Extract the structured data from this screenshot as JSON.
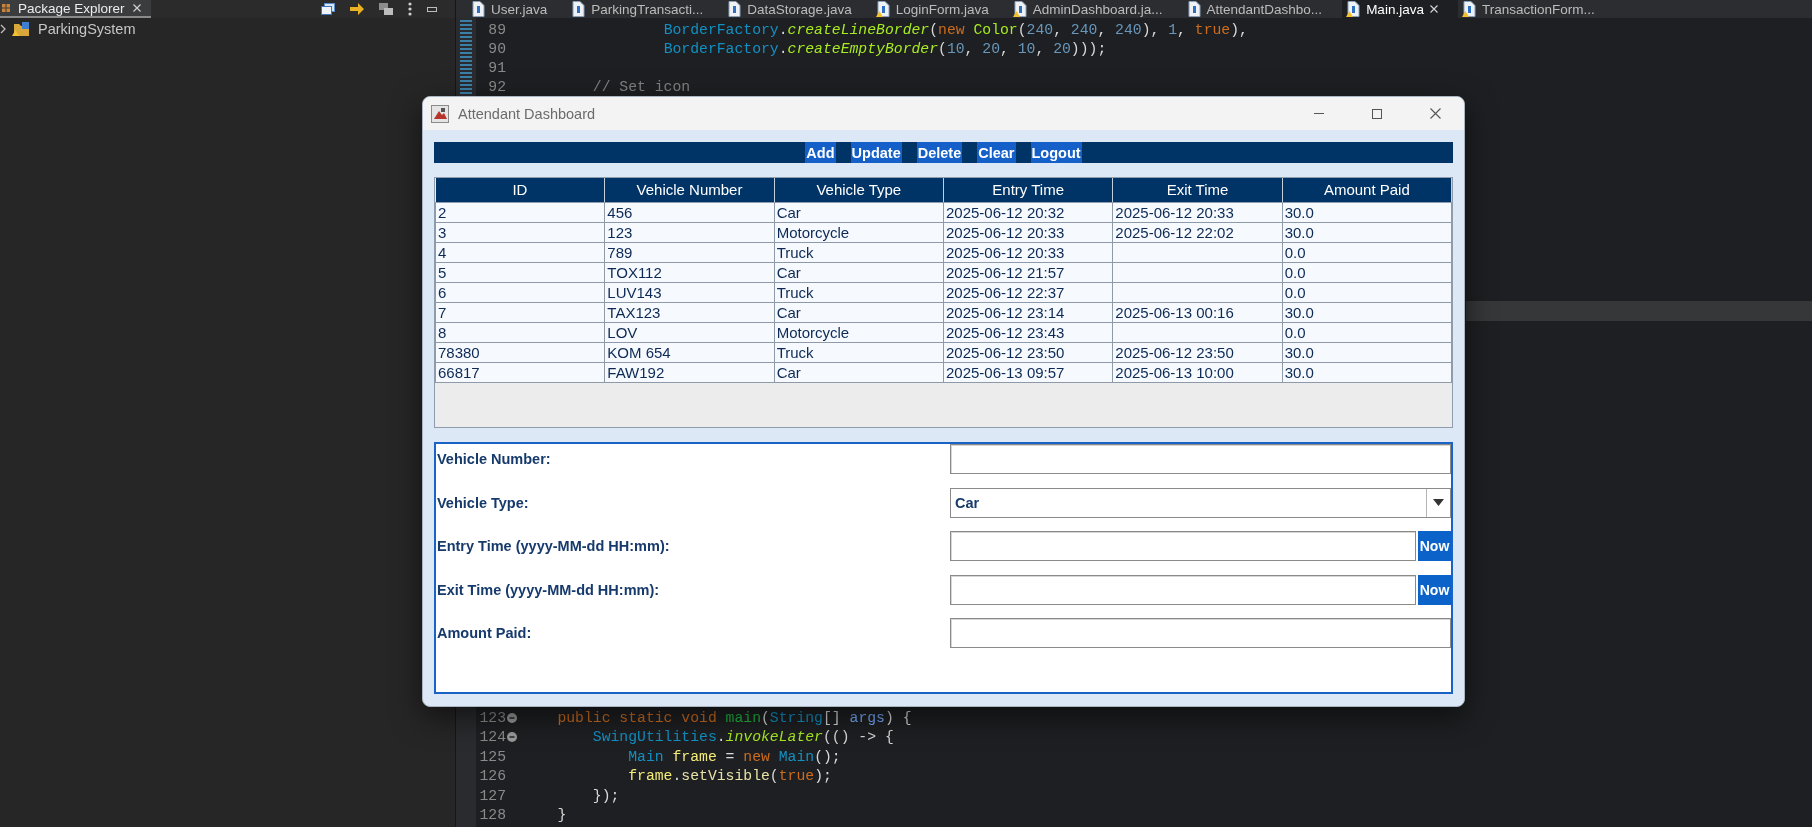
{
  "ide": {
    "package_explorer": {
      "title": "Package Explorer",
      "tree": [
        {
          "label": "ParkingSystem",
          "expanded": false,
          "selected": false
        }
      ]
    },
    "editor_tabs": [
      {
        "label": "User.java",
        "warning": false,
        "selected": false
      },
      {
        "label": "ParkingTransacti...",
        "warning": false,
        "selected": false
      },
      {
        "label": "DataStorage.java",
        "warning": false,
        "selected": false
      },
      {
        "label": "LoginForm.java",
        "warning": true,
        "selected": false
      },
      {
        "label": "AdminDashboard.ja...",
        "warning": true,
        "selected": false
      },
      {
        "label": "AttendantDashbo...",
        "warning": false,
        "selected": false
      },
      {
        "label": "Main.java",
        "warning": true,
        "selected": true
      },
      {
        "label": "TransactionForm...",
        "warning": true,
        "selected": false
      }
    ],
    "code_top": [
      {
        "number": "89",
        "foldable": false,
        "tokens": [
          {
            "kind": "type",
            "text": "                BorderFactory"
          },
          {
            "kind": "plain",
            "text": "."
          },
          {
            "kind": "method",
            "text": "createLineBorder"
          },
          {
            "kind": "plain",
            "text": "("
          },
          {
            "kind": "keyword",
            "text": "new "
          },
          {
            "kind": "constructor",
            "text": "Color"
          },
          {
            "kind": "plain",
            "text": "("
          },
          {
            "kind": "number",
            "text": "240"
          },
          {
            "kind": "plain",
            "text": ", "
          },
          {
            "kind": "number",
            "text": "240"
          },
          {
            "kind": "plain",
            "text": ", "
          },
          {
            "kind": "number",
            "text": "240"
          },
          {
            "kind": "plain",
            "text": "), "
          },
          {
            "kind": "number",
            "text": "1"
          },
          {
            "kind": "plain",
            "text": ", "
          },
          {
            "kind": "keyword",
            "text": "true"
          },
          {
            "kind": "plain",
            "text": "),"
          }
        ]
      },
      {
        "number": "90",
        "foldable": false,
        "tokens": [
          {
            "kind": "type",
            "text": "                BorderFactory"
          },
          {
            "kind": "plain",
            "text": "."
          },
          {
            "kind": "method",
            "text": "createEmptyBorder"
          },
          {
            "kind": "plain",
            "text": "("
          },
          {
            "kind": "number",
            "text": "10"
          },
          {
            "kind": "plain",
            "text": ", "
          },
          {
            "kind": "number",
            "text": "20"
          },
          {
            "kind": "plain",
            "text": ", "
          },
          {
            "kind": "number",
            "text": "10"
          },
          {
            "kind": "plain",
            "text": ", "
          },
          {
            "kind": "number",
            "text": "20"
          },
          {
            "kind": "plain",
            "text": ")));"
          }
        ]
      },
      {
        "number": "91",
        "foldable": false
      },
      {
        "number": "92",
        "foldable": false,
        "tokens": [
          {
            "kind": "comment",
            "text": "        // Set icon"
          }
        ]
      }
    ],
    "code_bottom": [
      {
        "number": "123",
        "foldable": true,
        "tokens": [
          {
            "kind": "keyword",
            "text": "    public static void "
          },
          {
            "kind": "declaration",
            "text": "main"
          },
          {
            "kind": "plain",
            "text": "("
          },
          {
            "kind": "type",
            "text": "String"
          },
          {
            "kind": "plain",
            "text": "[] "
          },
          {
            "kind": "param",
            "text": "args"
          },
          {
            "kind": "plain",
            "text": ") {"
          }
        ]
      },
      {
        "number": "124",
        "foldable": true,
        "tokens": [
          {
            "kind": "type",
            "text": "        SwingUtilities"
          },
          {
            "kind": "plain",
            "text": "."
          },
          {
            "kind": "method",
            "text": "invokeLater"
          },
          {
            "kind": "plain",
            "text": "(() -> {"
          }
        ]
      },
      {
        "number": "125",
        "foldable": false,
        "tokens": [
          {
            "kind": "type",
            "text": "            Main "
          },
          {
            "kind": "variable",
            "text": "frame"
          },
          {
            "kind": "plain",
            "text": " = "
          },
          {
            "kind": "keyword",
            "text": "new "
          },
          {
            "kind": "type",
            "text": "Main"
          },
          {
            "kind": "plain",
            "text": "();"
          }
        ]
      },
      {
        "number": "126",
        "foldable": false,
        "tokens": [
          {
            "kind": "variable",
            "text": "            frame"
          },
          {
            "kind": "plain",
            "text": "."
          },
          {
            "kind": "call",
            "text": "setVisible"
          },
          {
            "kind": "plain",
            "text": "("
          },
          {
            "kind": "keyword",
            "text": "true"
          },
          {
            "kind": "plain",
            "text": ");"
          }
        ]
      },
      {
        "number": "127",
        "foldable": false,
        "tokens": [
          {
            "kind": "plain",
            "text": "        });"
          }
        ]
      },
      {
        "number": "128",
        "foldable": false,
        "tokens": [
          {
            "kind": "plain",
            "text": "    }"
          }
        ]
      }
    ]
  },
  "dialog": {
    "title": "Attendant Dashboard",
    "toolbar": [
      "Add",
      "Update",
      "Delete",
      "Clear",
      "Logout"
    ],
    "table": {
      "columns": [
        "ID",
        "Vehicle Number",
        "Vehicle Type",
        "Entry Time",
        "Exit Time",
        "Amount Paid"
      ],
      "rows": [
        {
          "id": "2",
          "vehicle_number": "456",
          "vehicle_type": "Car",
          "entry_time": "2025-06-12 20:32",
          "exit_time": "2025-06-12 20:33",
          "amount_paid": "30.0",
          "selected": false
        },
        {
          "id": "3",
          "vehicle_number": "123",
          "vehicle_type": "Motorcycle",
          "entry_time": "2025-06-12 20:33",
          "exit_time": "2025-06-12 22:02",
          "amount_paid": "30.0",
          "selected": false
        },
        {
          "id": "4",
          "vehicle_number": "789",
          "vehicle_type": "Truck",
          "entry_time": "2025-06-12 20:33",
          "amount_paid": "0.0",
          "selected": false
        },
        {
          "id": "5",
          "vehicle_number": "TOX112",
          "vehicle_type": "Car",
          "entry_time": "2025-06-12 21:57",
          "amount_paid": "0.0",
          "selected": false
        },
        {
          "id": "6",
          "vehicle_number": "LUV143",
          "vehicle_type": "Truck",
          "entry_time": "2025-06-12 22:37",
          "amount_paid": "0.0",
          "selected": false
        },
        {
          "id": "7",
          "vehicle_number": "TAX123",
          "vehicle_type": "Car",
          "entry_time": "2025-06-12 23:14",
          "exit_time": "2025-06-13 00:16",
          "amount_paid": "30.0",
          "selected": false
        },
        {
          "id": "8",
          "vehicle_number": "LOV",
          "vehicle_type": "Motorcycle",
          "entry_time": "2025-06-12 23:43",
          "amount_paid": "0.0",
          "selected": false
        },
        {
          "id": "78380",
          "vehicle_number": "KOM 654",
          "vehicle_type": "Truck",
          "entry_time": "2025-06-12 23:50",
          "exit_time": "2025-06-12 23:50",
          "amount_paid": "30.0",
          "selected": false
        },
        {
          "id": "66817",
          "vehicle_number": "FAW192",
          "vehicle_type": "Car",
          "entry_time": "2025-06-13 09:57",
          "exit_time": "2025-06-13 10:00",
          "amount_paid": "30.0",
          "selected": false
        }
      ]
    },
    "form": {
      "fields": [
        {
          "kind": "text",
          "label": "Vehicle Number:"
        },
        {
          "kind": "select",
          "label": "Vehicle Type:",
          "value": "Car"
        },
        {
          "kind": "datetime",
          "label": "Entry Time (yyyy-MM-dd HH:mm):",
          "button": "Now"
        },
        {
          "kind": "datetime",
          "label": "Exit Time (yyyy-MM-dd HH:mm):",
          "button": "Now"
        },
        {
          "kind": "text",
          "label": "Amount Paid:"
        }
      ]
    }
  }
}
